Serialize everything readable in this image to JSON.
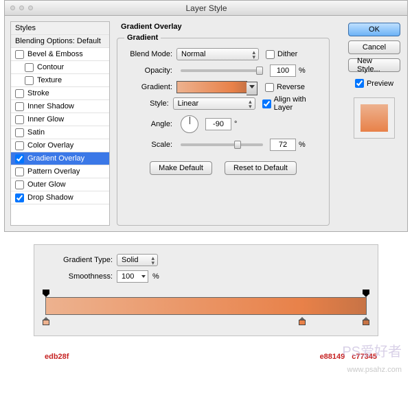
{
  "window": {
    "title": "Layer Style"
  },
  "sidebar": {
    "header": "Styles",
    "subheader": "Blending Options: Default",
    "items": [
      {
        "label": "Bevel & Emboss",
        "checked": false,
        "indent": false,
        "selected": false
      },
      {
        "label": "Contour",
        "checked": false,
        "indent": true,
        "selected": false
      },
      {
        "label": "Texture",
        "checked": false,
        "indent": true,
        "selected": false
      },
      {
        "label": "Stroke",
        "checked": false,
        "indent": false,
        "selected": false
      },
      {
        "label": "Inner Shadow",
        "checked": false,
        "indent": false,
        "selected": false
      },
      {
        "label": "Inner Glow",
        "checked": false,
        "indent": false,
        "selected": false
      },
      {
        "label": "Satin",
        "checked": false,
        "indent": false,
        "selected": false
      },
      {
        "label": "Color Overlay",
        "checked": false,
        "indent": false,
        "selected": false
      },
      {
        "label": "Gradient Overlay",
        "checked": true,
        "indent": false,
        "selected": true
      },
      {
        "label": "Pattern Overlay",
        "checked": false,
        "indent": false,
        "selected": false
      },
      {
        "label": "Outer Glow",
        "checked": false,
        "indent": false,
        "selected": false
      },
      {
        "label": "Drop Shadow",
        "checked": true,
        "indent": false,
        "selected": false
      }
    ]
  },
  "panel": {
    "section": "Gradient Overlay",
    "fieldset": "Gradient",
    "labels": {
      "blend_mode": "Blend Mode:",
      "opacity": "Opacity:",
      "gradient": "Gradient:",
      "style": "Style:",
      "angle": "Angle:",
      "scale": "Scale:",
      "dither": "Dither",
      "reverse": "Reverse",
      "align": "Align with Layer",
      "degree": "°",
      "percent": "%"
    },
    "values": {
      "blend_mode": "Normal",
      "opacity": "100",
      "style": "Linear",
      "angle": "-90",
      "scale": "72",
      "dither": false,
      "reverse": false,
      "align": true,
      "gradient_css": "linear-gradient(90deg,#edb28f 0%,#e88149 80%,#c77345 100%)"
    },
    "buttons": {
      "make_default": "Make Default",
      "reset": "Reset to Default"
    }
  },
  "right": {
    "ok": "OK",
    "cancel": "Cancel",
    "new_style": "New Style...",
    "preview": "Preview",
    "preview_checked": true,
    "preview_swatch_css": "linear-gradient(180deg,#edb28f,#e88149)"
  },
  "grad_editor": {
    "labels": {
      "type": "Gradient Type:",
      "smoothness": "Smoothness:",
      "percent": "%"
    },
    "type": "Solid",
    "smoothness": "100",
    "bar_css": "linear-gradient(90deg,#edb28f 0%,#e88149 80%,#c77345 100%)",
    "opacity_stops_pct": [
      0,
      100
    ],
    "color_stops": [
      {
        "pct": 0,
        "color": "#edb28f"
      },
      {
        "pct": 80,
        "color": "#e88149"
      },
      {
        "pct": 100,
        "color": "#c77345"
      }
    ]
  },
  "hex_labels": {
    "c1": "edb28f",
    "c2": "e88149",
    "c3": "c77345"
  },
  "watermark": {
    "line1": "PS爱好者",
    "line2": "www.psahz.com"
  }
}
